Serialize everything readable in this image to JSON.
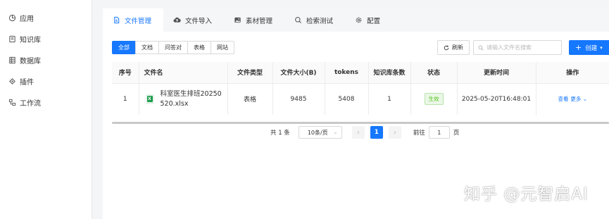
{
  "sidebar": {
    "items": [
      {
        "label": "应用",
        "icon": "app-icon"
      },
      {
        "label": "知识库",
        "icon": "knowledge-icon"
      },
      {
        "label": "数据库",
        "icon": "database-icon"
      },
      {
        "label": "插件",
        "icon": "plugin-icon"
      },
      {
        "label": "工作流",
        "icon": "workflow-icon"
      }
    ]
  },
  "tabs": [
    {
      "label": "文件管理",
      "icon": "file-icon"
    },
    {
      "label": "文件导入",
      "icon": "cloud-upload-icon"
    },
    {
      "label": "素材管理",
      "icon": "image-icon"
    },
    {
      "label": "检索测试",
      "icon": "search-icon"
    },
    {
      "label": "配置",
      "icon": "gear-icon"
    }
  ],
  "filters": [
    "全部",
    "文档",
    "问答对",
    "表格",
    "网站"
  ],
  "toolbar": {
    "refresh_label": "刷新",
    "search_placeholder": "请输入文件名搜索",
    "create_label": "创建"
  },
  "table": {
    "columns": [
      "序号",
      "文件名",
      "文件类型",
      "文件大小(B)",
      "tokens",
      "知识库条数",
      "状态",
      "更新时间",
      "操作"
    ],
    "rows": [
      {
        "index": "1",
        "file_icon": "X",
        "name": "科室医生排班20250520.xlsx",
        "type": "表格",
        "size": "9485",
        "tokens": "5408",
        "kb_count": "1",
        "status": "生效",
        "updated": "2025-05-20T16:48:01",
        "view": "查看",
        "more": "更多"
      }
    ]
  },
  "pagination": {
    "total": "共 1 条",
    "page_size": "10条/页",
    "current": "1",
    "goto_label": "前往",
    "goto_value": "1",
    "page_unit": "页"
  },
  "watermark": "知乎 @元智启AI",
  "colors": {
    "accent": "#1677ff",
    "status_green": "#52c41a"
  }
}
